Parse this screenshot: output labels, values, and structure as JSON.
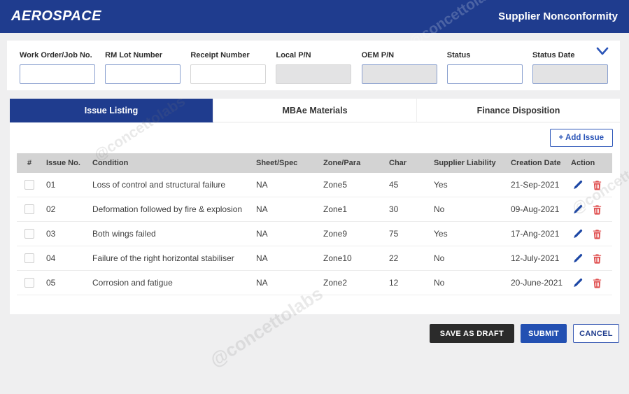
{
  "header": {
    "brand": "AEROSPACE",
    "title": "Supplier Nonconformity"
  },
  "filters": [
    {
      "label": "Work Order/Job No.",
      "border": "blue",
      "filled": false
    },
    {
      "label": "RM Lot Number",
      "border": "blue",
      "filled": false
    },
    {
      "label": "Receipt Number",
      "border": "gray",
      "filled": false
    },
    {
      "label": "Local P/N",
      "border": "gray",
      "filled": true
    },
    {
      "label": "OEM P/N",
      "border": "blue",
      "filled": true
    },
    {
      "label": "Status",
      "border": "blue",
      "filled": false
    },
    {
      "label": "Status Date",
      "border": "blue",
      "filled": true
    }
  ],
  "tabs": [
    {
      "label": "Issue Listing",
      "active": true
    },
    {
      "label": "MBAe Materials",
      "active": false
    },
    {
      "label": "Finance Disposition",
      "active": false
    }
  ],
  "add_issue_label": "+ Add Issue",
  "table": {
    "columns": [
      "#",
      "Issue No.",
      "Condition",
      "Sheet/Spec",
      "Zone/Para",
      "Char",
      "Supplier Liability",
      "Creation Date",
      "Action"
    ],
    "rows": [
      {
        "issue_no": "01",
        "condition": "Loss of control and structural failure",
        "sheet_spec": "NA",
        "zone_para": "Zone5",
        "char": "45",
        "supplier_liability": "Yes",
        "creation_date": "21-Sep-2021"
      },
      {
        "issue_no": "02",
        "condition": "Deformation followed by fire & explosion",
        "sheet_spec": "NA",
        "zone_para": "Zone1",
        "char": "30",
        "supplier_liability": "No",
        "creation_date": "09-Aug-2021"
      },
      {
        "issue_no": "03",
        "condition": "Both wings failed",
        "sheet_spec": "NA",
        "zone_para": "Zone9",
        "char": "75",
        "supplier_liability": "Yes",
        "creation_date": "17-Ang-2021"
      },
      {
        "issue_no": "04",
        "condition": "Failure of the right horizontal stabiliser",
        "sheet_spec": "NA",
        "zone_para": "Zone10",
        "char": "22",
        "supplier_liability": "No",
        "creation_date": "12-July-2021"
      },
      {
        "issue_no": "05",
        "condition": "Corrosion and fatigue",
        "sheet_spec": "NA",
        "zone_para": "Zone2",
        "char": "12",
        "supplier_liability": "No",
        "creation_date": "20-June-2021"
      }
    ]
  },
  "footer": {
    "save_draft_label": "SAVE AS DRAFT",
    "submit_label": "SUBMIT",
    "cancel_label": "CANCEL"
  },
  "watermark": "@concettolabs",
  "colors": {
    "navy": "#1f3c8e",
    "submit_blue": "#2350b2",
    "accent_blue": "#2b55b8",
    "edit_blue": "#1d47a5",
    "delete_red": "#e05252",
    "draft_black": "#2b2b2b",
    "table_header_gray": "#d3d3d3",
    "page_bg": "#efeff0"
  }
}
